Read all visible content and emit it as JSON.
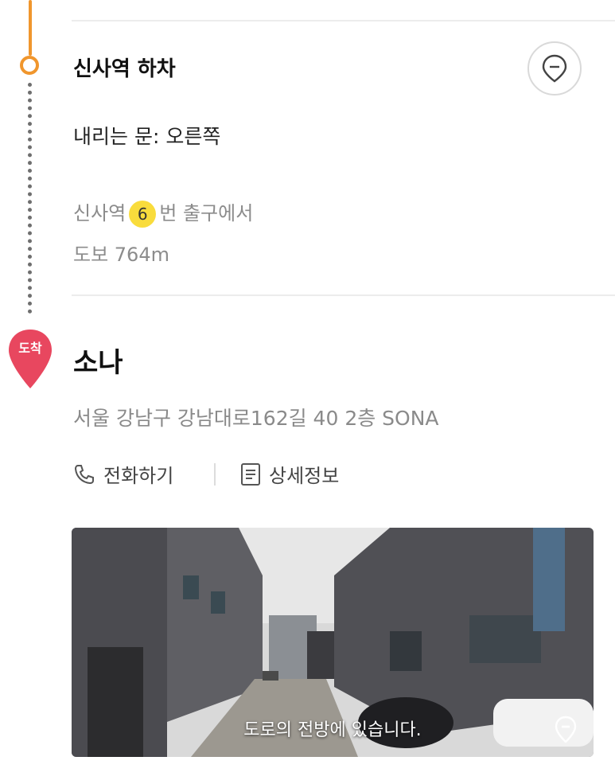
{
  "step": {
    "title": "신사역 하차",
    "door": "내리는 문: 오른쪽",
    "exit_prefix": "신사역",
    "exit_number": "6",
    "exit_suffix": "번 출구에서",
    "walk": "도보 764m"
  },
  "arrival": {
    "badge": "도착",
    "name": "소나",
    "address": "서울 강남구 강남대로162길 40 2층 SONA",
    "call_label": "전화하기",
    "detail_label": "상세정보"
  },
  "photo": {
    "caption": "도로의 전방에 있습니다."
  },
  "colors": {
    "route": "#f0962d",
    "arrival_pin": "#e8475f",
    "exit_badge": "#f9dc3c"
  },
  "icons": [
    "location-pin-icon",
    "phone-icon",
    "document-icon",
    "arrival-pin-icon"
  ]
}
